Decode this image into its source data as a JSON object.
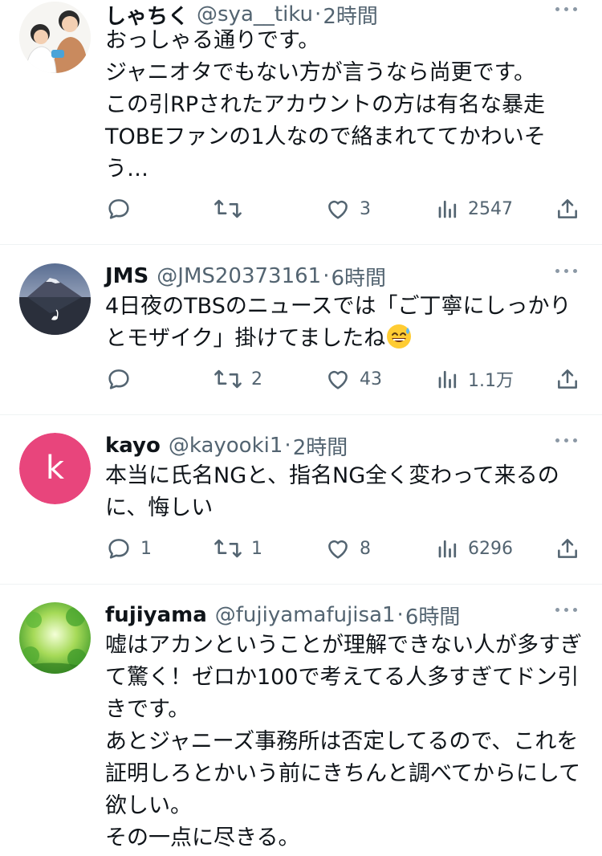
{
  "tweets": [
    {
      "name": "しゃちく",
      "handle": "@sya__tiku",
      "dot": "·",
      "time": "2時間",
      "text": "おっしゃる通りです。\nジャニオタでもない方が言うなら尚更です。\nこの引RPされたアカウントの方は有名な暴走TOBEファンの1人なので絡まれててかわいそう…",
      "reply_count": "",
      "retweet_count": "",
      "like_count": "3",
      "view_count": "2547"
    },
    {
      "name": "JMS",
      "handle": "@JMS20373161",
      "dot": "·",
      "time": "6時間",
      "text": "4日夜のTBSのニュースでは「ご丁寧にしっかりとモザイク」掛けてましたね",
      "emoji": "sweat-smile-emoji",
      "reply_count": "",
      "retweet_count": "2",
      "like_count": "43",
      "view_count": "1.1万"
    },
    {
      "name": "kayo",
      "handle": "@kayooki1",
      "dot": "·",
      "time": "2時間",
      "avatar_letter": "k",
      "avatar_color": "#e8457c",
      "text": "本当に氏名NGと、指名NG全く変わって来るのに、悔しい",
      "reply_count": "1",
      "retweet_count": "1",
      "like_count": "8",
      "view_count": "6296"
    },
    {
      "name": "fujiyama",
      "handle": "@fujiyamafujisa1",
      "dot": "·",
      "time": "6時間",
      "text": "嘘はアカンということが理解できない人が多すぎて驚く！ゼロか100で考えてる人多すぎてドン引きです。\nあとジャニーズ事務所は否定してるので、これを証明しろとかいう前にきちんと調べてからにして欲しい。\nその一点に尽きる。"
    }
  ],
  "colors": {
    "secondary_text": "#536471",
    "divider": "#eff3f4"
  },
  "icons": [
    "reply-icon",
    "retweet-icon",
    "like-icon",
    "views-icon",
    "share-icon",
    "more-icon"
  ]
}
